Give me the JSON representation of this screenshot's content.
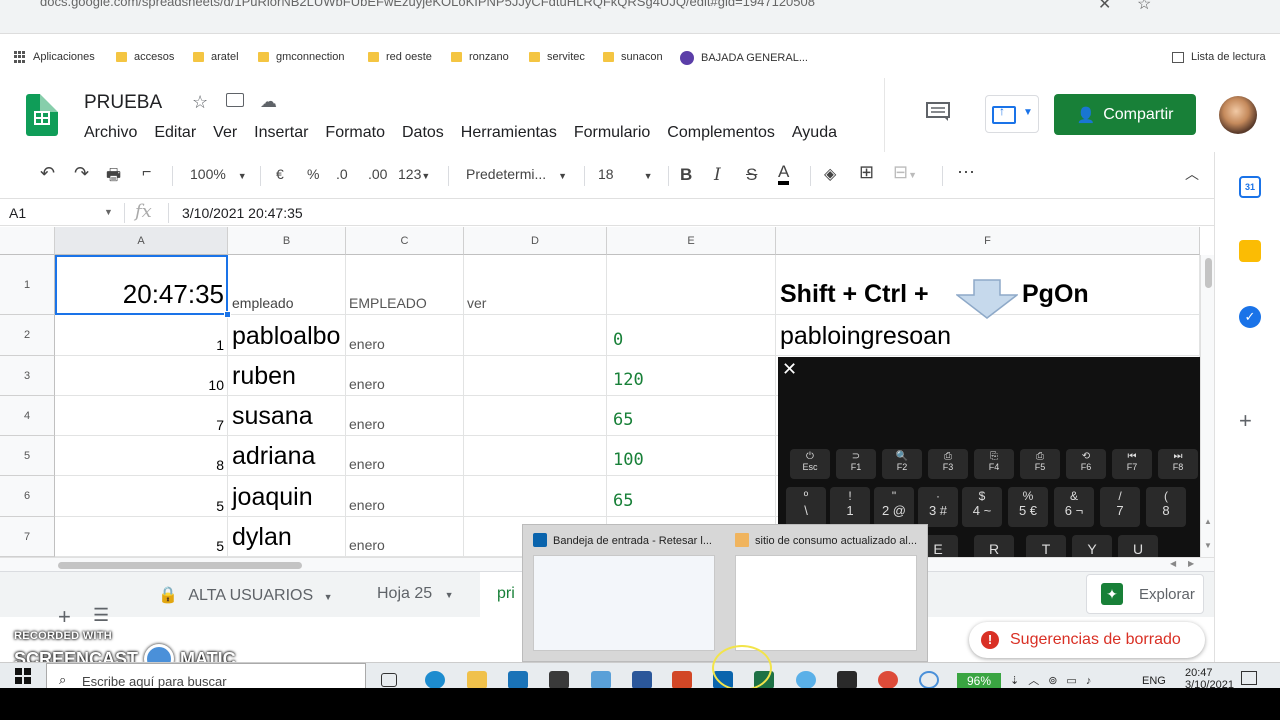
{
  "browser": {
    "url_fragment": "docs.google.com/spreadsheets/d/1PuRlorNB2LUWbFUbEFwEzuyjeKOLoKIPNP5JJyCFdtuHLRQFkQRSg4UJQ/edit#gid=1947120508",
    "bookmarks": [
      {
        "label": "Aplicaciones",
        "icon": "apps-grid-icon"
      },
      {
        "label": "accesos",
        "icon": "folder-icon"
      },
      {
        "label": "aratel",
        "icon": "folder-icon"
      },
      {
        "label": "gmconnection",
        "icon": "folder-icon"
      },
      {
        "label": "red oeste",
        "icon": "folder-icon"
      },
      {
        "label": "ronzano",
        "icon": "folder-icon"
      },
      {
        "label": "servitec",
        "icon": "folder-icon"
      },
      {
        "label": "sunacon",
        "icon": "folder-icon"
      },
      {
        "label": "BAJADA GENERAL...",
        "icon": "globe-icon"
      }
    ],
    "reading_list": "Lista de lectura"
  },
  "doc": {
    "title": "PRUEBA",
    "menus": [
      "Archivo",
      "Editar",
      "Ver",
      "Insertar",
      "Formato",
      "Datos",
      "Herramientas",
      "Formulario",
      "Complementos",
      "Ayuda"
    ],
    "share_label": "Compartir"
  },
  "toolbar": {
    "zoom": "100%",
    "currency": "€",
    "percent": "%",
    "dec_less": ".0",
    "dec_more": ".00",
    "format_more": "123",
    "font": "Predetermi...",
    "font_size": "18",
    "bold": "B",
    "italic": "I",
    "strike": "S",
    "textcolor": "A",
    "more": "⋯"
  },
  "formula_bar": {
    "cell_ref": "A1",
    "fx": "fx",
    "value": "3/10/2021 20:47:35"
  },
  "columns": [
    "A",
    "B",
    "C",
    "D",
    "E",
    "F"
  ],
  "rows": [
    {
      "n": "1",
      "a": "20:47:35",
      "b": "empleado",
      "c": "EMPLEADO",
      "d": "ver",
      "e": "",
      "f1": "Shift + Ctrl +",
      "f2": "PgOn"
    },
    {
      "n": "2",
      "a": "1",
      "b": "pabloalbo",
      "c": "enero",
      "d": "",
      "e": "0",
      "f1": "pabloingresoan",
      "f2": ""
    },
    {
      "n": "3",
      "a": "10",
      "b": "ruben",
      "c": "enero",
      "d": "",
      "e": "120",
      "f1": "",
      "f2": ""
    },
    {
      "n": "4",
      "a": "7",
      "b": "susana",
      "c": "enero",
      "d": "",
      "e": "65",
      "f1": "",
      "f2": ""
    },
    {
      "n": "5",
      "a": "8",
      "b": "adriana",
      "c": "enero",
      "d": "",
      "e": "100",
      "f1": "",
      "f2": ""
    },
    {
      "n": "6",
      "a": "5",
      "b": "joaquin",
      "c": "enero",
      "d": "",
      "e": "65",
      "f1": "",
      "f2": ""
    },
    {
      "n": "7",
      "a": "5",
      "b": "dylan",
      "c": "enero",
      "d": "",
      "e": "",
      "f1": "",
      "f2": ""
    }
  ],
  "keyboard": {
    "fn_row": [
      [
        "Esc",
        "⏻"
      ],
      [
        "F1",
        "⊃"
      ],
      [
        "F2",
        "🔍"
      ],
      [
        "F3",
        "⎙"
      ],
      [
        "F4",
        "⎘"
      ],
      [
        "F5",
        "⎙"
      ],
      [
        "F6",
        "⟲"
      ],
      [
        "F7",
        "⏮"
      ],
      [
        "F8",
        "⏭"
      ]
    ],
    "num_row": [
      [
        "º",
        "\\"
      ],
      [
        "!",
        "1"
      ],
      [
        "\"",
        "2 @"
      ],
      [
        "·",
        "3 #"
      ],
      [
        "$",
        "4 ~"
      ],
      [
        "%",
        "5 €"
      ],
      [
        "&",
        "6 ¬"
      ],
      [
        "/",
        "7"
      ],
      [
        "(",
        "8"
      ]
    ],
    "letter_row": [
      "E",
      "R",
      "T",
      "Y",
      "U"
    ]
  },
  "sheet_tabs": {
    "tab1": "ALTA USUARIOS",
    "tab2": "Hoja 25",
    "tab3": "pri",
    "explore": "Explorar"
  },
  "suggestion": {
    "icon": "!",
    "text": "Sugerencias de borrado"
  },
  "previews": [
    {
      "title": "Bandeja de entrada - Retesar l...",
      "app": "outlook-icon"
    },
    {
      "title": "sitio de consumo actualizado al...",
      "app": "mail-icon"
    }
  ],
  "watermark": {
    "recorded": "RECORDED WITH",
    "brand1": "SCREENCAST",
    "brand2": "MATIC"
  },
  "taskbar": {
    "search_placeholder": "Escribe aquí para buscar",
    "battery": "96%",
    "lang": "ENG",
    "time": "20:47",
    "date": "3/10/2021"
  },
  "colors": {
    "sheets_green": "#0f9d58",
    "share_green": "#188038",
    "select_blue": "#1a73e8",
    "number_green": "#188038",
    "error_red": "#d93025"
  }
}
